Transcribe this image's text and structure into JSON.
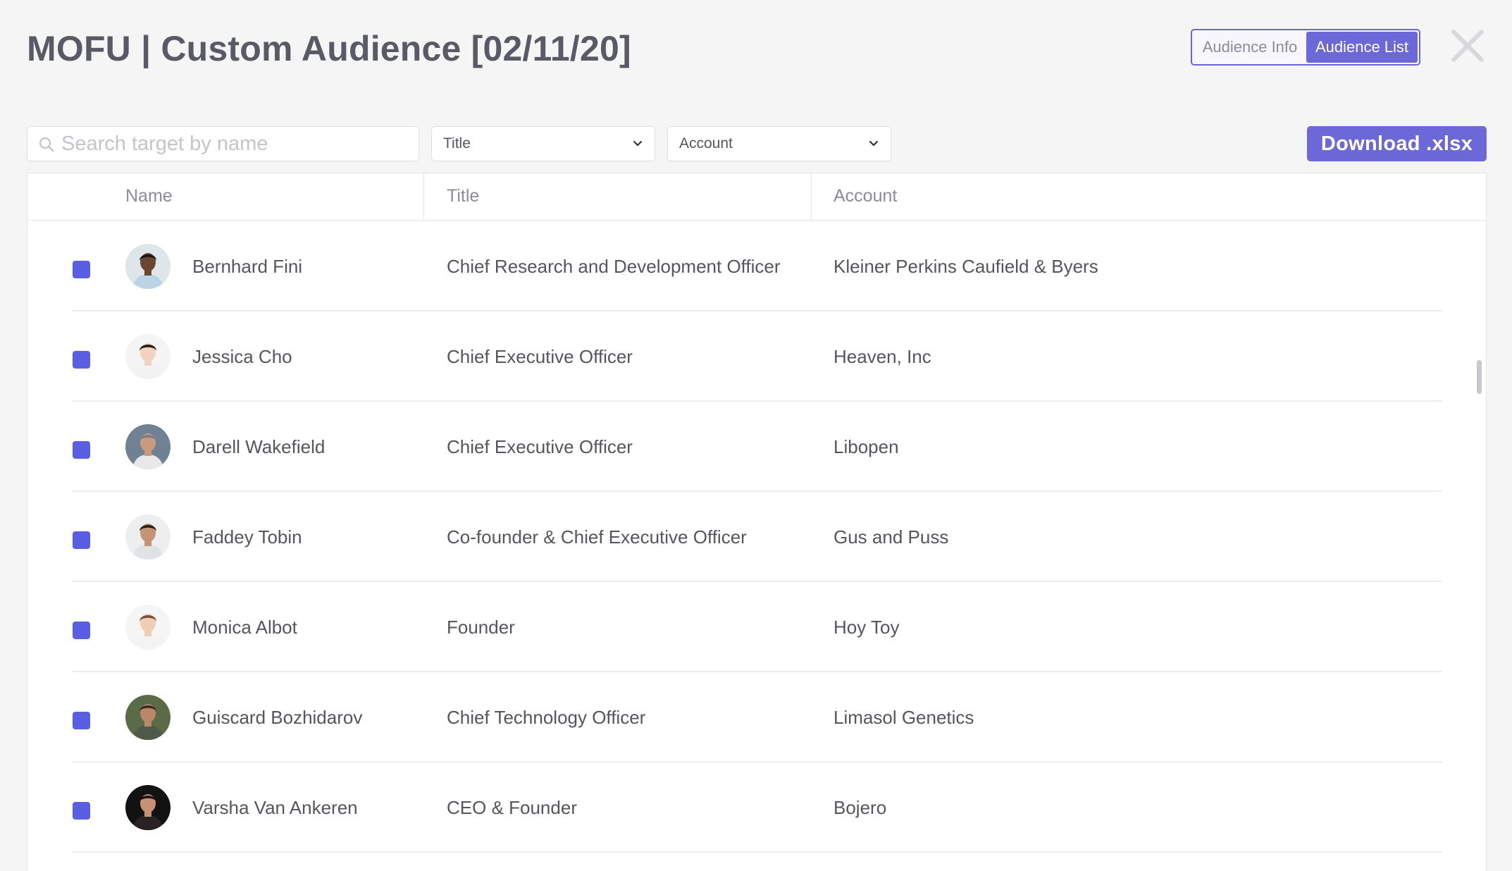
{
  "header": {
    "title": "MOFU | Custom Audience [02/11/20]",
    "tabs": [
      {
        "label": "Audience Info",
        "active": false
      },
      {
        "label": "Audience List",
        "active": true
      }
    ],
    "close_icon": "close-icon"
  },
  "toolbar": {
    "search_placeholder": "Search target by name",
    "search_value": "",
    "title_filter": "Title",
    "account_filter": "Account",
    "download_label": "Download .xlsx"
  },
  "table": {
    "columns": [
      "Name",
      "Title",
      "Account"
    ],
    "rows": [
      {
        "name": "Bernhard Fini",
        "title": "Chief Research and Development Officer",
        "account": "Kleiner Perkins Caufield & Byers",
        "checked": true,
        "avatar": {
          "skin": "#6b4630",
          "hair": "#1c1410",
          "shirt": "#bcd3e6",
          "bg": "#dfe6ea"
        }
      },
      {
        "name": "Jessica Cho",
        "title": "Chief Executive Officer",
        "account": "Heaven, Inc",
        "checked": true,
        "avatar": {
          "skin": "#f1d3bf",
          "hair": "#2b1d17",
          "shirt": "#f2f2f2",
          "bg": "#f4f4f4"
        }
      },
      {
        "name": "Darell Wakefield",
        "title": "Chief Executive Officer",
        "account": "Libopen",
        "checked": true,
        "avatar": {
          "skin": "#c99a7c",
          "hair": "#7d7d80",
          "shirt": "#e8e8ea",
          "bg": "#6f8192"
        }
      },
      {
        "name": "Faddey Tobin",
        "title": "Co-founder & Chief Executive Officer",
        "account": "Gus and Puss",
        "checked": true,
        "avatar": {
          "skin": "#c49474",
          "hair": "#2a201b",
          "shirt": "#dfe3e6",
          "bg": "#eceeef"
        }
      },
      {
        "name": "Monica Albot",
        "title": "Founder",
        "account": "Hoy Toy",
        "checked": true,
        "avatar": {
          "skin": "#efcdb6",
          "hair": "#7a5238",
          "shirt": "#f3f3f3",
          "bg": "#f5f5f5"
        }
      },
      {
        "name": "Guiscard Bozhidarov",
        "title": "Chief Technology Officer",
        "account": "Limasol Genetics",
        "checked": true,
        "avatar": {
          "skin": "#b9876a",
          "hair": "#3a2b20",
          "shirt": "#4f5a4a",
          "bg": "#5b6b48"
        }
      },
      {
        "name": "Varsha Van Ankeren",
        "title": "CEO & Founder",
        "account": "Bojero",
        "checked": true,
        "avatar": {
          "skin": "#c89176",
          "hair": "#1c1412",
          "shirt": "#2a2222",
          "bg": "#121212"
        }
      }
    ]
  },
  "colors": {
    "accent": "#6c68d8",
    "checkbox": "#5a5ee2"
  }
}
